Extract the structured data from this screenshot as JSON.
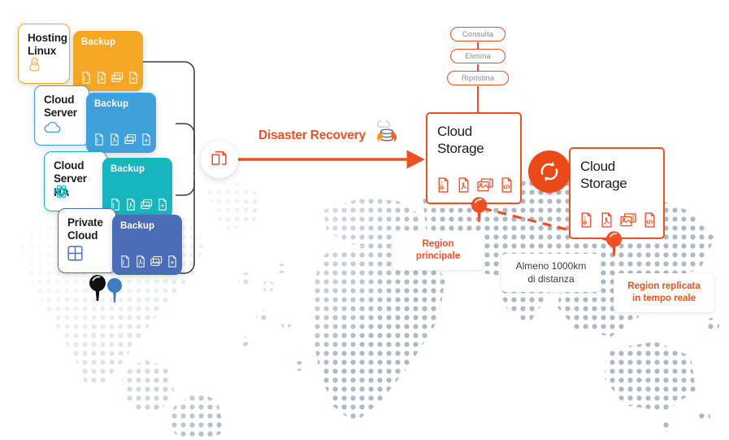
{
  "theme": {
    "orange": "#EF5023",
    "orange_deep": "#EA4A18",
    "amber": "#F4A723",
    "blue": "#3FA0DC",
    "teal": "#17B6BF",
    "indigo": "#4B6CB7",
    "map_dot": "#AEB9C4",
    "wire": "#3c4043",
    "text_dark": "#1d1d1f",
    "pill_text": "#8b8b8e"
  },
  "services": [
    {
      "title": "Hosting\nLinux",
      "icon": "linux-penguin-icon",
      "color": "#F4A723",
      "backup_label": "Backup",
      "backup_color": "#F4A723"
    },
    {
      "title": "Cloud\nServer",
      "icon": "cloud-icon",
      "color": "#3FA0DC",
      "backup_label": "Backup",
      "backup_color": "#3FA0DC"
    },
    {
      "title": "Cloud\nServer HA",
      "icon": "atom-icon",
      "color": "#17B6BF",
      "backup_label": "Backup",
      "backup_color": "#17B6BF"
    },
    {
      "title": "Private\nCloud",
      "icon": "grid-icon",
      "color": "#4B6CB7",
      "backup_label": "Backup",
      "backup_color": "#4B6CB7"
    }
  ],
  "backup_file_icons": [
    "document-file-icon",
    "pdf-file-icon",
    "images-stack-icon",
    "code-file-icon"
  ],
  "flow": {
    "copy_badge_icon": "copy-documents-icon",
    "disaster_recovery_label": "Disaster Recovery",
    "disaster_recovery_icon": "database-on-fire-icon",
    "sync_badge_icon": "sync-arrows-icon"
  },
  "actions": [
    {
      "label": "Consulta"
    },
    {
      "label": "Elimina"
    },
    {
      "label": "Ripristina"
    }
  ],
  "storages": [
    {
      "title": "Cloud\nStorage",
      "icons": [
        "zip-file-icon",
        "pdf-file-icon",
        "media-images-icon",
        "code-file-icon"
      ]
    },
    {
      "title": "Cloud\nStorage",
      "icons": [
        "zip-file-icon",
        "pdf-file-icon",
        "media-images-icon",
        "code-file-icon"
      ]
    }
  ],
  "labels": {
    "primary_region": "Region\nprincipale",
    "distance": "Almeno 1000km\ndi distanza",
    "replica_region": "Region replicata\nin tempo reale"
  },
  "map_pins": {
    "source_pin": "map-pin-black",
    "source_pin_secondary": "map-pin-blue",
    "primary_region_pin": "map-pin-orange",
    "replica_region_pin": "map-pin-orange"
  }
}
